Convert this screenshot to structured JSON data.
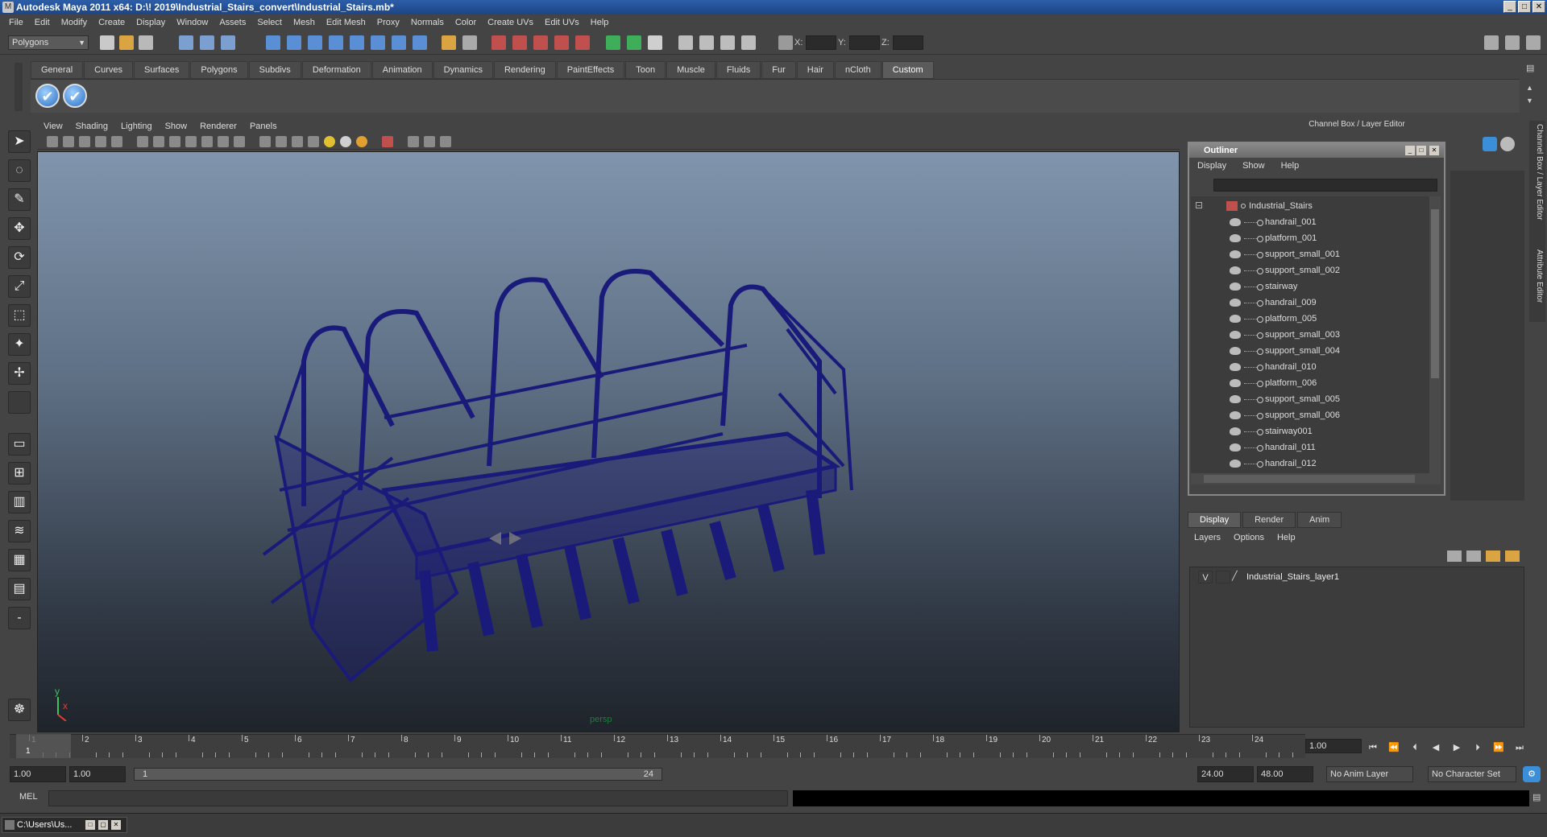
{
  "window": {
    "title": "Autodesk Maya 2011 x64: D:\\! 2019\\Industrial_Stairs_convert\\Industrial_Stairs.mb*"
  },
  "menus": [
    "File",
    "Edit",
    "Modify",
    "Create",
    "Display",
    "Window",
    "Assets",
    "Select",
    "Mesh",
    "Edit Mesh",
    "Proxy",
    "Normals",
    "Color",
    "Create UVs",
    "Edit UVs",
    "Help"
  ],
  "status_line": {
    "mode": "Polygons",
    "x_label": "X:",
    "y_label": "Y:",
    "z_label": "Z:"
  },
  "shelf": {
    "tabs": [
      "General",
      "Curves",
      "Surfaces",
      "Polygons",
      "Subdivs",
      "Deformation",
      "Animation",
      "Dynamics",
      "Rendering",
      "PaintEffects",
      "Toon",
      "Muscle",
      "Fluids",
      "Fur",
      "Hair",
      "nCloth",
      "Custom"
    ],
    "active_tab": "Custom",
    "icons": [
      "checkmark-icon",
      "checkmark-icon"
    ]
  },
  "viewport": {
    "menu": [
      "View",
      "Shading",
      "Lighting",
      "Show",
      "Renderer",
      "Panels"
    ],
    "camera": "persp",
    "axis_y": "y",
    "axis_x": "x",
    "mesh_color": "#1a1a7a"
  },
  "channel_box": {
    "title": "Channel Box / Layer Editor"
  },
  "side_tabs": {
    "channel": "Channel Box / Layer Editor",
    "attribute": "Attribute Editor"
  },
  "outliner": {
    "title": "Outliner",
    "menu": [
      "Display",
      "Show",
      "Help"
    ],
    "root": "Industrial_Stairs",
    "items": [
      "handrail_001",
      "platform_001",
      "support_small_001",
      "support_small_002",
      "stairway",
      "handrail_009",
      "platform_005",
      "support_small_003",
      "support_small_004",
      "handrail_010",
      "platform_006",
      "support_small_005",
      "support_small_006",
      "stairway001",
      "handrail_011",
      "handrail_012"
    ]
  },
  "layer_editor": {
    "tabs": [
      "Display",
      "Render",
      "Anim"
    ],
    "active_tab": "Display",
    "menu": [
      "Layers",
      "Options",
      "Help"
    ],
    "layers": [
      {
        "visible": "V",
        "name": "Industrial_Stairs_layer1"
      }
    ]
  },
  "time_slider": {
    "ticks": [
      "1",
      "2",
      "3",
      "4",
      "5",
      "6",
      "7",
      "8",
      "9",
      "10",
      "11",
      "12",
      "13",
      "14",
      "15",
      "16",
      "17",
      "18",
      "19",
      "20",
      "21",
      "22",
      "23",
      "24"
    ],
    "current_frame": "1.00",
    "current_marker": "1"
  },
  "range": {
    "start": "1.00",
    "playback_start": "1.00",
    "bar_start": "1",
    "bar_end": "24",
    "playback_end": "24.00",
    "end": "48.00",
    "anim_layer": "No Anim Layer",
    "character_set": "No Character Set"
  },
  "command_line": {
    "label": "MEL"
  },
  "taskbar": {
    "item": "C:\\Users\\Us..."
  }
}
